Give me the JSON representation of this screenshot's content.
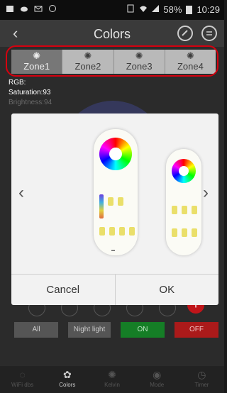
{
  "status_bar": {
    "battery": "58%",
    "time": "10:29"
  },
  "header": {
    "title": "Colors",
    "back_icon": "‹"
  },
  "zones": [
    {
      "label": "Zone1",
      "active": true
    },
    {
      "label": "Zone2",
      "active": false
    },
    {
      "label": "Zone3",
      "active": false
    },
    {
      "label": "Zone4",
      "active": false
    }
  ],
  "info": {
    "rgb": "RGB:",
    "saturation": "Saturation:93",
    "brightness": "Brightness:94"
  },
  "dialog": {
    "cancel_label": "Cancel",
    "ok_label": "OK",
    "prev_icon": "‹",
    "next_icon": "›"
  },
  "controls": {
    "all_label": "All",
    "night_label": "Night light",
    "on_label": "ON",
    "off_label": "OFF"
  },
  "bottom_nav": [
    {
      "label": "WiFi dbs",
      "active": false
    },
    {
      "label": "Colors",
      "active": true
    },
    {
      "label": "Kelvin",
      "active": false
    },
    {
      "label": "Mode",
      "active": false
    },
    {
      "label": "Timer",
      "active": false
    }
  ],
  "colors": {
    "zone_outline": "#d6000f",
    "on_button": "#157e26",
    "off_button": "#ab1a1a"
  }
}
